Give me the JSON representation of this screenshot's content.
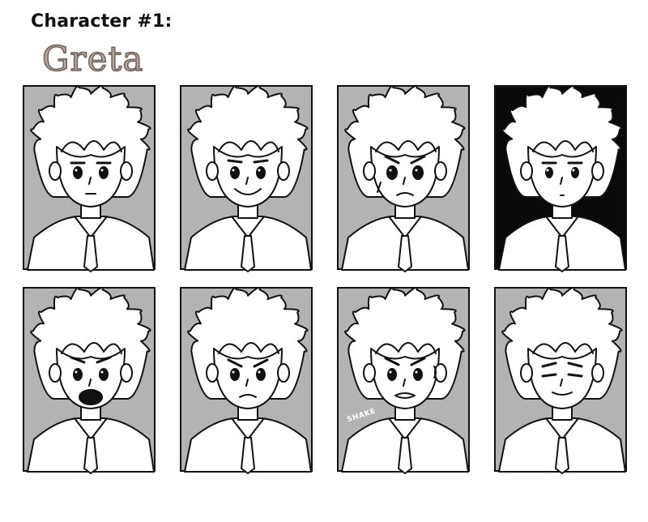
{
  "header": {
    "title": "Character #1:",
    "character_name": "Greta"
  },
  "colors": {
    "panel_gray": "#b3b3b3",
    "panel_black": "#0a0a0a",
    "ink": "#111111",
    "skin": "#ffffff",
    "name_fill": "#b7a79b"
  },
  "panels": [
    {
      "id": 1,
      "expression": "neutral",
      "background": "gray"
    },
    {
      "id": 2,
      "expression": "happy",
      "background": "gray"
    },
    {
      "id": 3,
      "expression": "teary",
      "background": "gray"
    },
    {
      "id": 4,
      "expression": "blank",
      "background": "black"
    },
    {
      "id": 5,
      "expression": "shocked",
      "background": "gray"
    },
    {
      "id": 6,
      "expression": "worried",
      "background": "gray"
    },
    {
      "id": 7,
      "expression": "nervous",
      "background": "gray"
    },
    {
      "id": 8,
      "expression": "smug",
      "background": "gray"
    }
  ],
  "sfx": {
    "shake": "SHAKE"
  }
}
